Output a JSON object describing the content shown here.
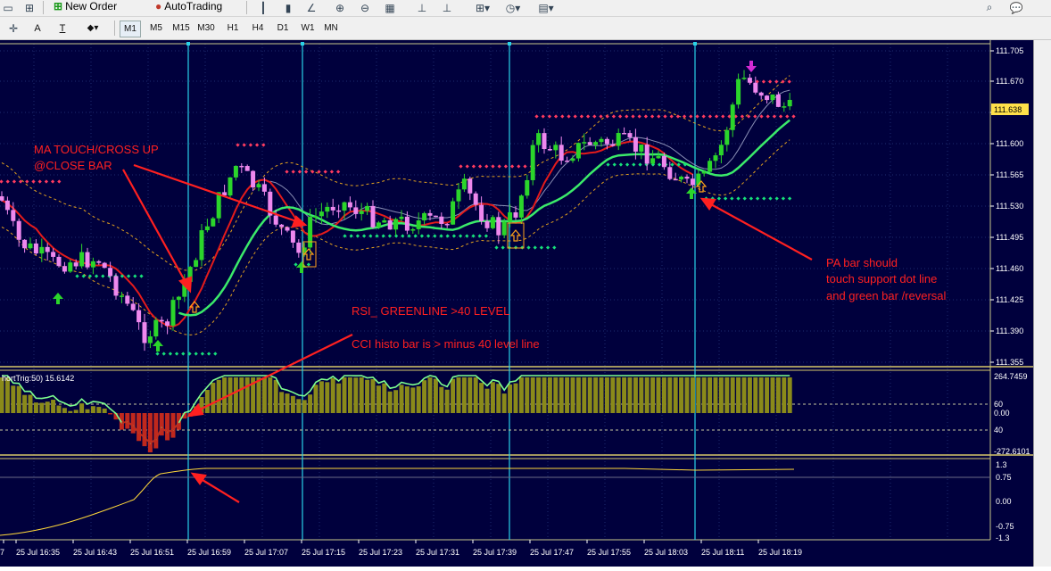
{
  "toolbar": {
    "new_order_label": "New Order",
    "autotrading_label": "AutoTrading",
    "timeframes": [
      "M1",
      "M5",
      "M15",
      "M30",
      "H1",
      "H4",
      "D1",
      "W1",
      "MN"
    ],
    "active_timeframe": "M1",
    "tool_a_label": "A",
    "tool_t_label": "T"
  },
  "colors": {
    "background": "#00003d",
    "grid": "#1e2b6e",
    "bull": "#2bd52b",
    "bear": "#ee88ee",
    "cyan_line": "#29d3e8",
    "ma_fast": "#e41b1b",
    "ma_slow": "#3bea6a",
    "band": "#e3a21e",
    "resistance_dots": "#ff3b5f",
    "support_dots": "#16e07a",
    "annotation": "#ff2020",
    "rsi": "#7dff8f",
    "cci_up": "#8a8a1a",
    "cci_down": "#c0281d",
    "bottom_line": "#ffd83a"
  },
  "main_axis": {
    "labels": [
      "111.705",
      "111.670",
      "111.635",
      "111.600",
      "111.565",
      "111.530",
      "111.495",
      "111.460",
      "111.425",
      "111.390",
      "111.355"
    ],
    "current_price": "111.638"
  },
  "sub1": {
    "title": "hortTrig:50) 15.6142",
    "labels": [
      "264.7459",
      "60",
      "0.00",
      "40",
      "-272.6101"
    ]
  },
  "sub2": {
    "labels": [
      "1.3",
      "0.75",
      "0.00",
      "-0.75",
      "-1.3"
    ]
  },
  "time_labels": [
    "7",
    "25 Jul 16:35",
    "25 Jul 16:43",
    "25 Jul 16:51",
    "25 Jul 16:59",
    "25 Jul 17:07",
    "25 Jul 17:15",
    "25 Jul 17:23",
    "25 Jul 17:31",
    "25 Jul 17:39",
    "25 Jul 17:47",
    "25 Jul 17:55",
    "25 Jul 18:03",
    "25 Jul 18:11",
    "25 Jul 18:19"
  ],
  "annotations": {
    "ma_touch_line1": "MA TOUCH/CROSS UP",
    "ma_touch_line2": "@CLOSE BAR",
    "rsi_note": "RSI_ GREENLINE >40 LEVEL",
    "cci_note": "CCI histo bar is > minus 40 level line",
    "pa_line1": "PA bar should",
    "pa_line2": "touch support dot line",
    "pa_line3": "and green bar /reversal"
  },
  "icons": [
    "new-order-icon",
    "autotrading-icon",
    "zoom-in-icon",
    "zoom-out-icon",
    "clock-icon",
    "search-icon",
    "chat-icon"
  ]
}
